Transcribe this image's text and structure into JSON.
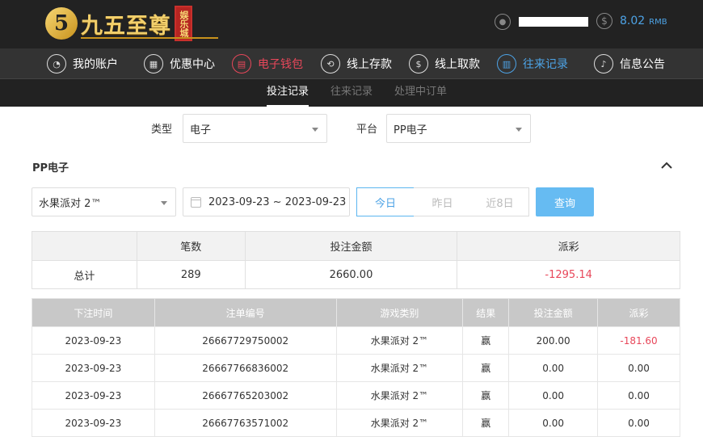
{
  "header": {
    "logo_mark": "5",
    "logo_text": "九五至尊",
    "logo_sub": "娱乐城",
    "balance_value": "8.02",
    "balance_unit": "RMB"
  },
  "nav": {
    "items": [
      {
        "label": "我的账户",
        "icon": "user-icon"
      },
      {
        "label": "优惠中心",
        "icon": "gift-icon"
      },
      {
        "label": "电子钱包",
        "icon": "wallet-icon"
      },
      {
        "label": "线上存款",
        "icon": "deposit-icon"
      },
      {
        "label": "线上取款",
        "icon": "withdraw-icon"
      },
      {
        "label": "往来记录",
        "icon": "records-icon"
      },
      {
        "label": "信息公告",
        "icon": "bell-icon"
      }
    ]
  },
  "subtabs": [
    "投注记录",
    "往来记录",
    "处理中订单"
  ],
  "filters": {
    "type_label": "类型",
    "type_value": "电子",
    "platform_label": "平台",
    "platform_value": "PP电子"
  },
  "section_title": "PP电子",
  "game_select": "水果派对 2™",
  "date_range": "2023-09-23 ~ 2023-09-23",
  "range_buttons": [
    "今日",
    "昨日",
    "近8日"
  ],
  "query_button": "查询",
  "summary": {
    "headers": [
      "",
      "笔数",
      "投注金额",
      "派彩"
    ],
    "row": [
      "总计",
      "289",
      "2660.00",
      "-1295.14"
    ]
  },
  "records": {
    "headers": [
      "下注时间",
      "注单编号",
      "游戏类别",
      "结果",
      "投注金额",
      "派彩"
    ],
    "rows": [
      [
        "2023-09-23",
        "26667729750002",
        "水果派对 2™",
        "赢",
        "200.00",
        "-181.60"
      ],
      [
        "2023-09-23",
        "26667766836002",
        "水果派对 2™",
        "赢",
        "0.00",
        "0.00"
      ],
      [
        "2023-09-23",
        "26667765203002",
        "水果派对 2™",
        "赢",
        "0.00",
        "0.00"
      ],
      [
        "2023-09-23",
        "26667763571002",
        "水果派对 2™",
        "赢",
        "0.00",
        "0.00"
      ]
    ]
  },
  "colors": {
    "accent_blue": "#4da3e6",
    "accent_red": "#e8475a",
    "header_bg": "#222222",
    "nav_bg": "#333333"
  }
}
